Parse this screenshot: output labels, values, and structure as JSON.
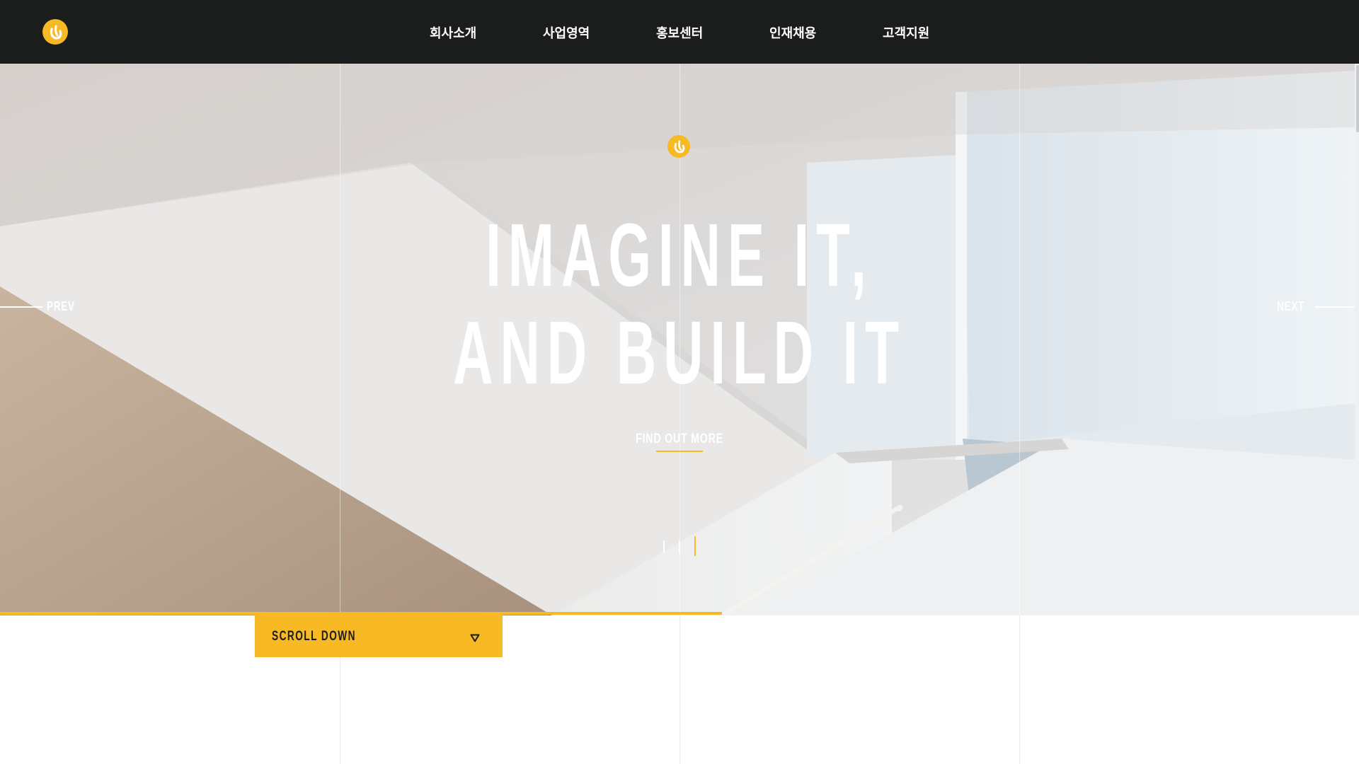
{
  "header": {
    "logo_icon": "brand-logo-icon",
    "nav": [
      {
        "label": "회사소개"
      },
      {
        "label": "사업영역"
      },
      {
        "label": "홍보센터"
      },
      {
        "label": "인재채용"
      },
      {
        "label": "고객지원"
      }
    ]
  },
  "hero": {
    "headline_line1": "IMAGINE IT,",
    "headline_line2": "AND BUILD IT",
    "cta_label": "FIND OUT MORE",
    "prev_label": "PREV",
    "next_label": "NEXT",
    "slides_total": 3,
    "active_slide": 3
  },
  "scroll_down": {
    "label": "SCROLL DOWN",
    "icon": "triangle-down-icon"
  },
  "colors": {
    "accent": "#f7b924",
    "header_bg": "#1b1c1c",
    "text_light": "#ffffff"
  }
}
